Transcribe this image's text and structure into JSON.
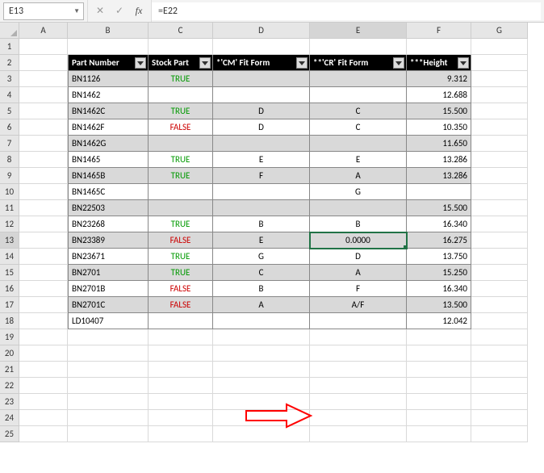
{
  "name_box": "E13",
  "formula": "=E22",
  "columns": [
    "A",
    "B",
    "C",
    "D",
    "E",
    "F",
    "G"
  ],
  "row_numbers": [
    1,
    2,
    3,
    4,
    5,
    6,
    7,
    8,
    9,
    10,
    11,
    12,
    13,
    14,
    15,
    16,
    17,
    18,
    19,
    20,
    21,
    22,
    23,
    24,
    25
  ],
  "selected": {
    "col": "E",
    "row": 13
  },
  "headers": [
    "Part Number",
    "Stock Part",
    "*'CM' Fit Form",
    "**'CR' Fit Form",
    "***Height"
  ],
  "chart_data": {
    "type": "table",
    "columns": [
      "Part Number",
      "Stock Part",
      "*'CM' Fit Form",
      "**'CR' Fit Form",
      "***Height"
    ],
    "rows": [
      {
        "part": "BN1126",
        "stock": "TRUE",
        "cm": "",
        "cr": "",
        "height": "9.312",
        "band": "odd"
      },
      {
        "part": "BN1462",
        "stock": "",
        "cm": "",
        "cr": "",
        "height": "12.688",
        "band": "even"
      },
      {
        "part": "BN1462C",
        "stock": "TRUE",
        "cm": "D",
        "cr": "C",
        "height": "15.500",
        "band": "odd"
      },
      {
        "part": "BN1462F",
        "stock": "FALSE",
        "cm": "D",
        "cr": "C",
        "height": "10.350",
        "band": "even"
      },
      {
        "part": "BN1462G",
        "stock": "",
        "cm": "",
        "cr": "",
        "height": "11.650",
        "band": "odd"
      },
      {
        "part": "BN1465",
        "stock": "TRUE",
        "cm": "E",
        "cr": "E",
        "height": "13.286",
        "band": "even"
      },
      {
        "part": "BN1465B",
        "stock": "TRUE",
        "cm": "F",
        "cr": "A",
        "height": "13.286",
        "band": "odd"
      },
      {
        "part": "BN1465C",
        "stock": "",
        "cm": "",
        "cr": "G",
        "height": "",
        "band": "even"
      },
      {
        "part": "BN22503",
        "stock": "",
        "cm": "",
        "cr": "",
        "height": "15.500",
        "band": "odd"
      },
      {
        "part": "BN23268",
        "stock": "TRUE",
        "cm": "B",
        "cr": "B",
        "height": "16.340",
        "band": "even"
      },
      {
        "part": "BN23389",
        "stock": "FALSE",
        "cm": "E",
        "cr": "0.0000",
        "height": "16.275",
        "band": "odd"
      },
      {
        "part": "BN23671",
        "stock": "TRUE",
        "cm": "G",
        "cr": "D",
        "height": "13.750",
        "band": "even"
      },
      {
        "part": "BN2701",
        "stock": "TRUE",
        "cm": "C",
        "cr": "A",
        "height": "15.250",
        "band": "odd"
      },
      {
        "part": "BN2701B",
        "stock": "FALSE",
        "cm": "B",
        "cr": "F",
        "height": "16.340",
        "band": "even"
      },
      {
        "part": "BN2701C",
        "stock": "FALSE",
        "cm": "A",
        "cr": "A/F",
        "height": "13.500",
        "band": "odd"
      },
      {
        "part": "LD10407",
        "stock": "",
        "cm": "",
        "cr": "",
        "height": "12.042",
        "band": "even"
      }
    ]
  }
}
